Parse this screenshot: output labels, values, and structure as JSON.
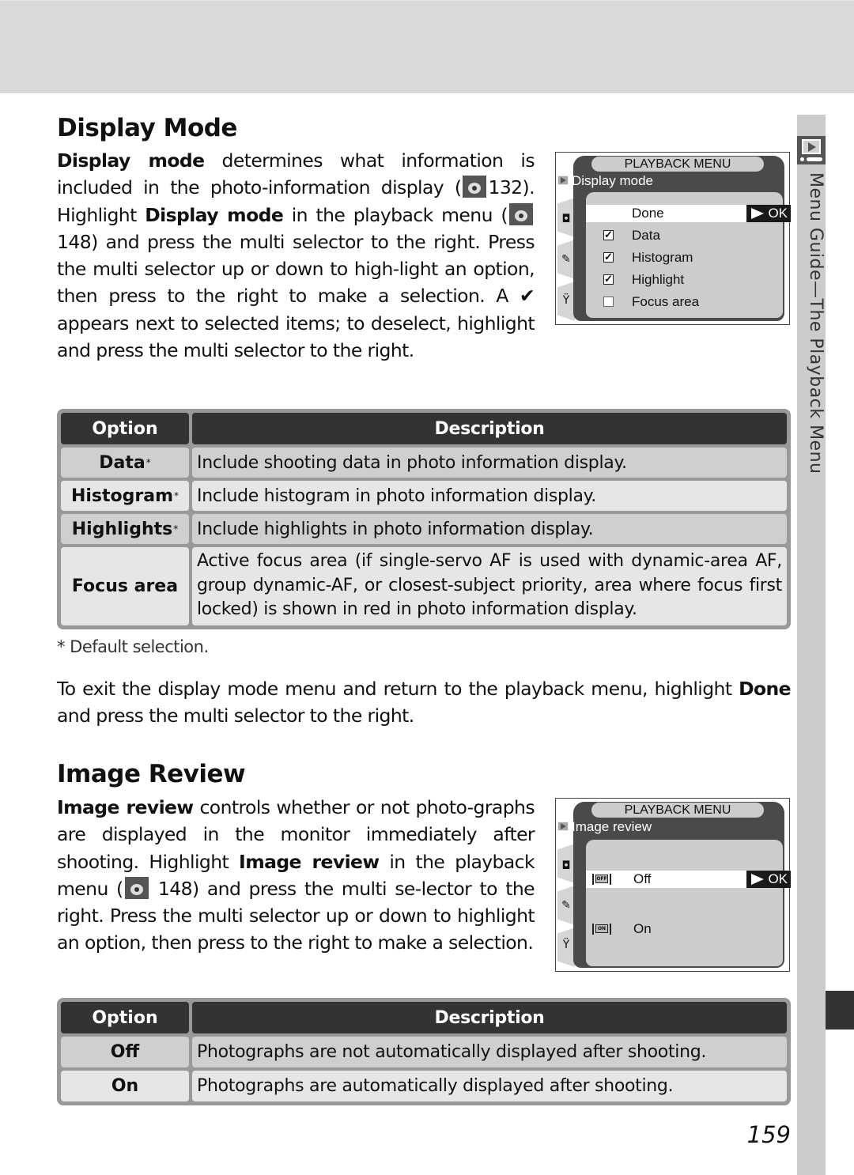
{
  "page_number": "159",
  "sidebar": {
    "icon": "playback-menu-icon",
    "label": "Menu Guide—The Playback Menu"
  },
  "display_mode": {
    "heading": "Display Mode",
    "intro": {
      "bold1": "Display mode",
      "t1": " determines what information is included in the photo-information display (",
      "ref1": "132",
      "t2": ").  Highlight ",
      "bold2": "Display mode",
      "t3": " in the playback menu (",
      "ref2": "148",
      "t4": ") and press the multi selector to the right.  Press the multi selector up or down to high-light an option, then press to the right to make a selection.  A ",
      "check": "✔",
      "t5": " appears next to selected items; to deselect, highlight and press the multi selector to the right."
    },
    "lcd": {
      "title": "PLAYBACK MENU",
      "subtitle": "Display mode",
      "items": [
        {
          "label": "Done",
          "checkbox": null,
          "selected": true,
          "ok_label": "OK"
        },
        {
          "label": "Data",
          "checkbox": true,
          "selected": false
        },
        {
          "label": "Histogram",
          "checkbox": true,
          "selected": false
        },
        {
          "label": "Highlight",
          "checkbox": true,
          "selected": false
        },
        {
          "label": "Focus area",
          "checkbox": false,
          "selected": false
        }
      ],
      "tab_icons": [
        "playback-icon",
        "camera-icon",
        "pencil-icon",
        "wrench-icon"
      ]
    },
    "table": {
      "headers": [
        "Option",
        "Description"
      ],
      "rows": [
        {
          "option": "Data",
          "asterisk": "*",
          "description": "Include shooting data in photo information display."
        },
        {
          "option": "Histogram",
          "asterisk": "*",
          "description": "Include histogram in photo information display."
        },
        {
          "option": "Highlights",
          "asterisk": "*",
          "description": "Include highlights in photo information display."
        },
        {
          "option": "Focus area",
          "asterisk": "",
          "description": "Active focus area (if single-servo AF is used with dynamic-area AF, group dynamic-AF, or closest-subject priority, area where focus first locked) is shown in red in photo information display."
        }
      ]
    },
    "footnote": "* Default selection.",
    "exit_text": {
      "t1": "To exit the display mode menu and return to the playback menu, highlight ",
      "bold": "Done",
      "t2": " and press the multi selector to the right."
    }
  },
  "image_review": {
    "heading": "Image Review",
    "intro": {
      "bold1": "Image review",
      "t1": " controls whether or not photo-graphs are displayed in the monitor immediately after shooting.  Highlight ",
      "bold2": "Image review",
      "t2": " in the playback menu (",
      "ref": "148",
      "t3": ") and press the multi se-lector to the right.  Press the multi selector up or down to highlight an option, then press to the right to make a selection."
    },
    "lcd": {
      "title": "PLAYBACK MENU",
      "subtitle": "Image review",
      "items": [
        {
          "label": "Off",
          "icon_text": "OFF",
          "selected": true,
          "ok_label": "OK"
        },
        {
          "label": "On",
          "icon_text": "ON",
          "selected": false
        }
      ]
    },
    "table": {
      "headers": [
        "Option",
        "Description"
      ],
      "rows": [
        {
          "option": "Off",
          "description": "Photographs are not automatically displayed after shooting."
        },
        {
          "option": "On",
          "description": "Photographs are automatically displayed after shooting."
        }
      ]
    }
  }
}
